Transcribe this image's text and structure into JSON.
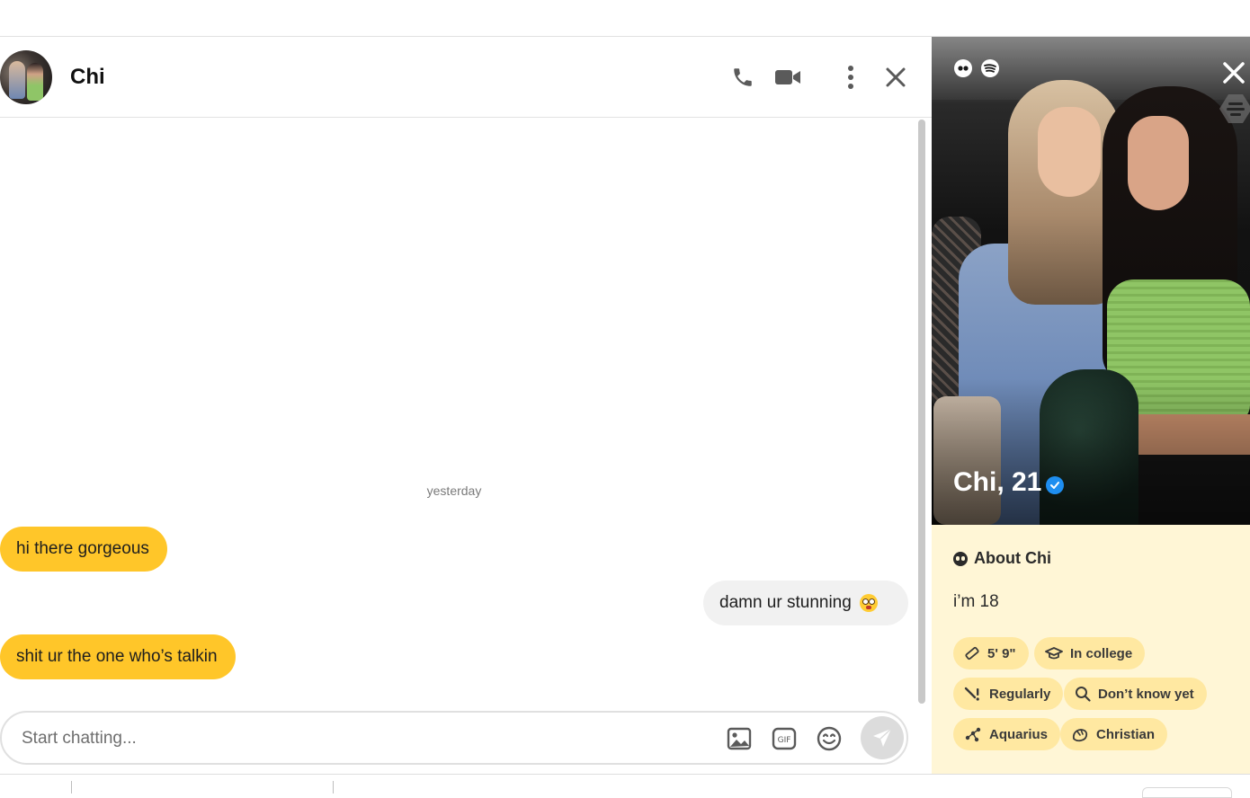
{
  "chat": {
    "contact_name": "Chi",
    "date_separator": "yesterday",
    "messages": [
      {
        "direction": "in",
        "text": "hi there gorgeous"
      },
      {
        "direction": "out",
        "text": "damn ur stunning",
        "emoji": "flushed-face"
      },
      {
        "direction": "in",
        "text": "shit ur the one who’s talkin"
      }
    ],
    "composer": {
      "placeholder": "Start chatting..."
    },
    "header_icons": [
      "phone-icon",
      "video-camera-icon",
      "more-vertical-icon",
      "close-icon"
    ],
    "composer_icons": [
      "image-icon",
      "gif-icon",
      "emoji-icon",
      "send-icon"
    ]
  },
  "profile": {
    "name_age": "Chi, 21",
    "verified": true,
    "about_heading": "About Chi",
    "about_text": "i’m 18",
    "tags": [
      {
        "icon": "ruler-icon",
        "label": "5' 9\""
      },
      {
        "icon": "graduation-cap-icon",
        "label": "In college"
      },
      {
        "icon": "exercise-icon",
        "label": "Regularly"
      },
      {
        "icon": "magnifier-icon",
        "label": "Don’t know yet"
      },
      {
        "icon": "zodiac-icon",
        "label": "Aquarius"
      },
      {
        "icon": "religion-icon",
        "label": "Christian"
      }
    ],
    "photo_icons": [
      "quote-icon",
      "spotify-icon"
    ]
  },
  "colors": {
    "incoming_bubble": "#ffc629",
    "outgoing_bubble": "#f1f1f1",
    "profile_background": "#fff6d6",
    "tag_background": "#ffe8a1",
    "verified_badge": "#1e8ef0"
  }
}
